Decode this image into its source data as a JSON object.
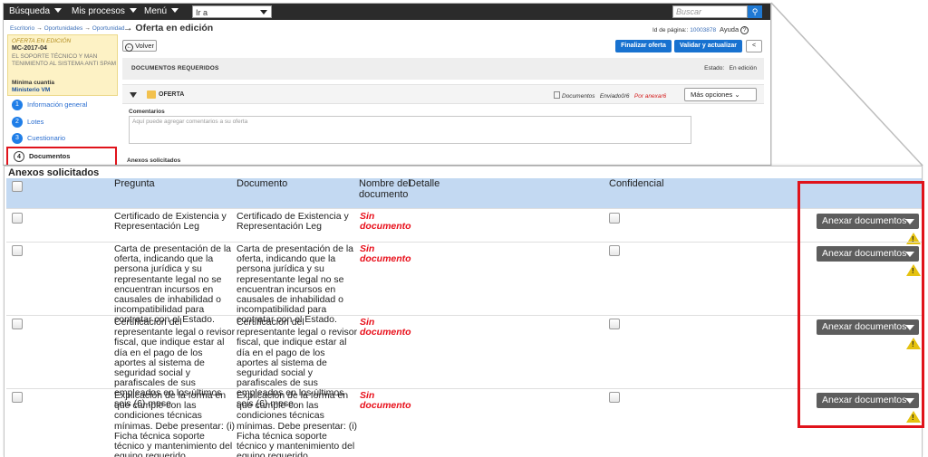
{
  "topbar": {
    "search_menu": "Búsqueda",
    "processes_menu": "Mis procesos",
    "main_menu": "Menú",
    "goto_value": "Ir a",
    "search_placeholder": "Buscar"
  },
  "breadcrumb": {
    "items": [
      "Escritorio",
      "Oportunidades",
      "Oportunidad"
    ],
    "arrow": "→"
  },
  "page": {
    "title": "→ Oferta en edición",
    "id_label": "Id de página::",
    "id_value": "10003878",
    "help_label": "Ayuda",
    "help_icon": "?"
  },
  "process": {
    "status": "OFERTA EN EDICIÓN",
    "code": "MC-2017-04",
    "description": "EL SOPORTE TÉCNICO Y MAN TENIMIENTO AL SISTEMA ANTI SPAM",
    "modality": "Mínima cuantía",
    "entity": "Ministerio VM"
  },
  "steps": [
    {
      "number": "1",
      "label": "Información general"
    },
    {
      "number": "2",
      "label": "Lotes"
    },
    {
      "number": "3",
      "label": "Cuestionario"
    },
    {
      "number": "4",
      "label": "Documentos"
    }
  ],
  "toolbar": {
    "volver_label": "Volver",
    "finalizar_label": "Finalizar oferta",
    "validar_label": "Validar y actualizar",
    "collapse_label": "<"
  },
  "docs_section": {
    "title": "DOCUMENTOS REQUERIDOS",
    "state_label": "Estado:",
    "state_value": "En edición"
  },
  "oferta_section": {
    "label": "OFERTA",
    "documents_label": "Documentos",
    "sent_label": "Enviado0/6",
    "pending_label": "Por anexar6",
    "more_options_label": "Más opciones"
  },
  "comments": {
    "label": "Comentarios",
    "placeholder": "Aquí puede agregar comentarios a su oferta"
  },
  "anexos": {
    "title": "Anexos solicitados",
    "headers": {
      "question": "Pregunta",
      "document": "Documento",
      "doc_name": "Nombre del documento",
      "detail": "Detalle",
      "confidential": "Confidencial"
    },
    "attach_label": "Anexar documentos",
    "warn_glyph": "!",
    "rows": [
      {
        "question": "Certificado de Existencia y Representación Leg",
        "document": "Certificado de Existencia y Representación Leg",
        "doc_name": "Sin documento"
      },
      {
        "question": "Carta de presentación de la oferta, indicando que la persona jurídica y su representante legal no se encuentran incursos en causales de inhabilidad o incompatibilidad para contratar con el Estado.",
        "document": "Carta de presentación de la oferta, indicando que la persona jurídica y su representante legal no se encuentran incursos en causales de inhabilidad o incompatibilidad para contratar con el Estado.",
        "doc_name": "Sin documento"
      },
      {
        "question": "Certificación del representante legal o revisor fiscal, que indique estar al día en el pago de los aportes al sistema de seguridad social y parafiscales de sus empleados en los últimos seis (6) mese",
        "document": "Certificación del representante legal o revisor fiscal, que indique estar al día en el pago de los aportes al sistema de seguridad social y parafiscales de sus empleados en los últimos seis (6) mese",
        "doc_name": "Sin documento"
      },
      {
        "question": "Explicación de la forma en que cumple con las condiciones técnicas mínimas. Debe presentar: (i) Ficha técnica soporte técnico y mantenimiento del equipo requerido.",
        "document": "Explicación de la forma en que cumple con las condiciones técnicas mínimas. Debe presentar: (i) Ficha técnica soporte técnico y mantenimiento del equipo requerido.",
        "doc_name": "Sin documento"
      }
    ]
  },
  "colors": {
    "accent_blue": "#1872d0",
    "header_blue": "#c3d9f2",
    "highlight_red": "#e0131b",
    "warning_yellow": "#e5c210"
  }
}
